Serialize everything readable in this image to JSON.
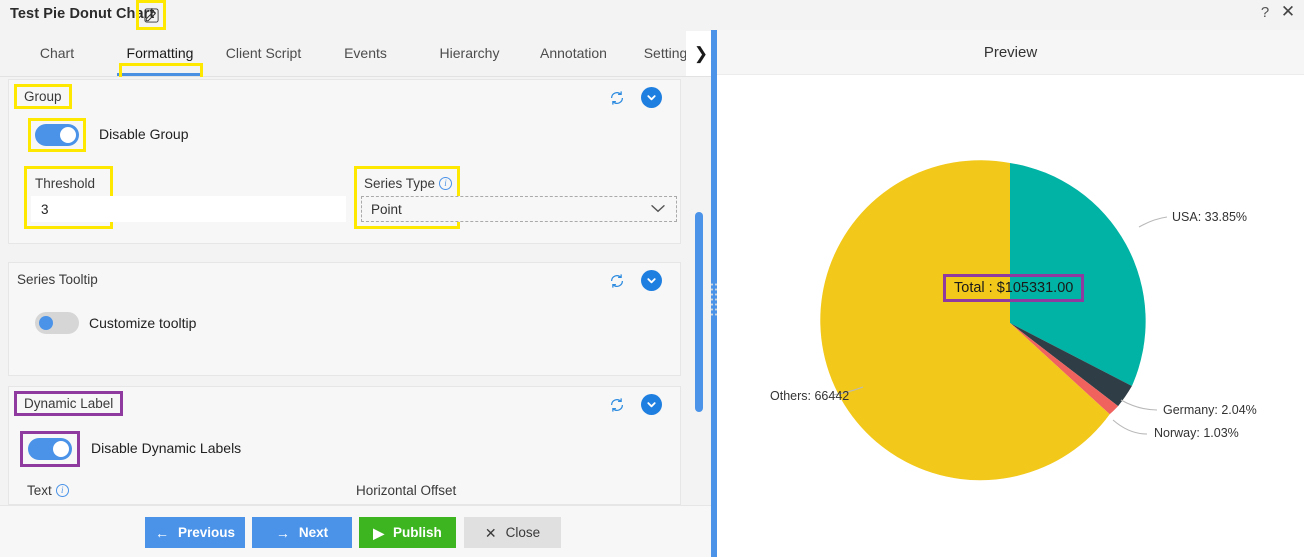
{
  "window": {
    "title": "Test Pie Donut Chart",
    "edit_icon": "pencil-edit-icon",
    "help_icon": "?",
    "close_icon": "✕"
  },
  "tabs": {
    "items": [
      {
        "label": "Chart",
        "active": false
      },
      {
        "label": "Formatting",
        "active": true
      },
      {
        "label": "Client Script",
        "active": false
      },
      {
        "label": "Events",
        "active": false
      },
      {
        "label": "Hierarchy",
        "active": false
      },
      {
        "label": "Annotation",
        "active": false
      },
      {
        "label": "Settings",
        "active": false
      }
    ],
    "more_icon": "❯"
  },
  "sections": {
    "group": {
      "title": "Group",
      "refresh_icon": "refresh-icon",
      "collapse_icon": "chevron-down-icon",
      "disable_group": {
        "label": "Disable Group",
        "state": "on"
      },
      "threshold": {
        "label": "Threshold",
        "value": "3"
      },
      "series_type": {
        "label": "Series Type",
        "info_icon": "i",
        "value": "Point",
        "chevron": "chevron-down-icon"
      }
    },
    "series_tooltip": {
      "title": "Series Tooltip",
      "refresh_icon": "refresh-icon",
      "collapse_icon": "chevron-down-icon",
      "customize_tooltip": {
        "label": "Customize tooltip",
        "state": "off"
      }
    },
    "dynamic_label": {
      "title": "Dynamic Label",
      "refresh_icon": "refresh-icon",
      "collapse_icon": "chevron-down-icon",
      "disable_dynamic_labels": {
        "label": "Disable Dynamic Labels",
        "state": "on"
      },
      "text": {
        "label": "Text",
        "info_icon": "i"
      },
      "horizontal_offset": {
        "label": "Horizontal Offset"
      }
    }
  },
  "footer": {
    "previous": {
      "label": "Previous",
      "glyph": "←"
    },
    "next": {
      "label": "Next",
      "glyph": "→"
    },
    "publish": {
      "label": "Publish",
      "glyph": "▶"
    },
    "close": {
      "label": "Close",
      "glyph": "✕"
    }
  },
  "preview": {
    "header": "Preview",
    "center_label": "Total : $105331.00"
  },
  "chart_data": {
    "type": "pie",
    "title": "",
    "center_text": "Total : $105331.00",
    "total": 105331.0,
    "legend": "none",
    "labels_position": "outside-callout",
    "categories": [
      "Others",
      "USA",
      "Germany",
      "Norway"
    ],
    "values": [
      66442,
      35653,
      2149,
      1087
    ],
    "display_labels": [
      "Others: 66442",
      "USA: 33.85%",
      "Germany: 2.04%",
      "Norway: 1.03%"
    ],
    "percentages": [
      63.08,
      33.85,
      2.04,
      1.03
    ],
    "colors": [
      "#f2c81a",
      "#00b3a4",
      "#2f3e46",
      "#f0625e"
    ]
  },
  "highlights": {
    "yellow": "#ffe800",
    "purple": "#8e3a9e"
  }
}
